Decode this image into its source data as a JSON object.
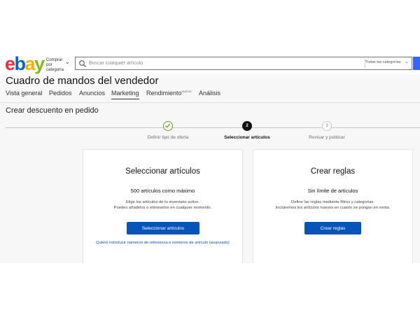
{
  "header": {
    "logo_letters": [
      "e",
      "b",
      "a",
      "y"
    ],
    "shop_by_category": "Comprar por categoría",
    "search_placeholder": "Buscar cualquier artículo",
    "search_category": "Todas las categorías"
  },
  "page_title": "Cuadro de mandos del vendedor",
  "nav": {
    "tabs": [
      {
        "label": "Vista general"
      },
      {
        "label": "Pedidos"
      },
      {
        "label": "Anuncios"
      },
      {
        "label": "Marketing",
        "active": true
      },
      {
        "label": "Rendimiento",
        "badge": "NUEVO"
      },
      {
        "label": "Análisis"
      }
    ]
  },
  "section_title": "Crear descuento en pedido",
  "stepper": {
    "steps": [
      {
        "number": "",
        "label": "Definir tipo de oferta",
        "status": "done"
      },
      {
        "number": "2",
        "label": "Seleccionar artículos",
        "status": "current"
      },
      {
        "number": "3",
        "label": "Revisar y publicar",
        "status": "upcoming"
      }
    ]
  },
  "cards": [
    {
      "title": "Seleccionar artículos",
      "subtitle": "500 artículos como máximo",
      "description_line1": "Elige los artículos de tu inventario activo.",
      "description_line2": "Puedes añadirlos o eliminarlos en cualquier momento.",
      "button": "Seleccionar artículos",
      "link": "Quiero introducir números de referencia o números de artículo (avanzado)"
    },
    {
      "title": "Crear reglas",
      "subtitle": "Sin límite de artículos",
      "description_line1": "Define las reglas mediante filtros y categorías.",
      "description_line2": "Incluiremos los artículos nuevos en cuanto se pongan en venta.",
      "button": "Crear reglas"
    }
  ],
  "colors": {
    "brand_red": "#e53238",
    "brand_blue": "#0064d2",
    "brand_yellow": "#f5af02",
    "brand_green": "#86b817",
    "primary_button": "#0654ba",
    "step_done": "#5ba71b"
  }
}
